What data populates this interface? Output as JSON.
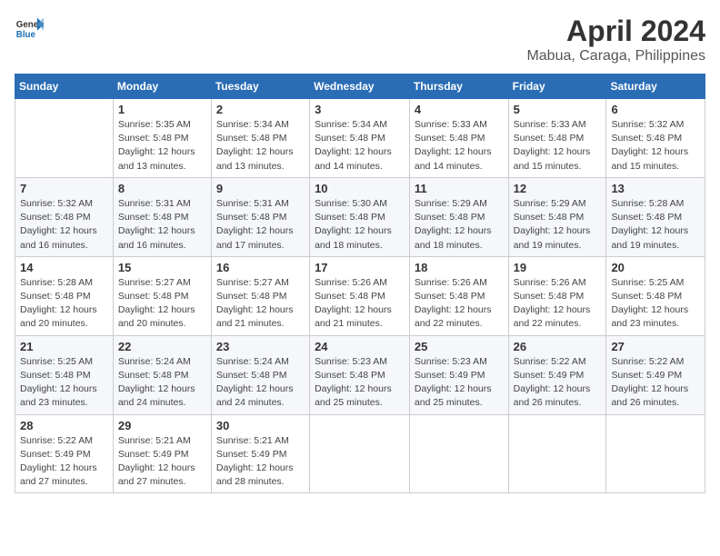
{
  "header": {
    "logo_line1": "General",
    "logo_line2": "Blue",
    "month": "April 2024",
    "location": "Mabua, Caraga, Philippines"
  },
  "columns": [
    "Sunday",
    "Monday",
    "Tuesday",
    "Wednesday",
    "Thursday",
    "Friday",
    "Saturday"
  ],
  "weeks": [
    [
      {
        "day": "",
        "info": ""
      },
      {
        "day": "1",
        "info": "Sunrise: 5:35 AM\nSunset: 5:48 PM\nDaylight: 12 hours\nand 13 minutes."
      },
      {
        "day": "2",
        "info": "Sunrise: 5:34 AM\nSunset: 5:48 PM\nDaylight: 12 hours\nand 13 minutes."
      },
      {
        "day": "3",
        "info": "Sunrise: 5:34 AM\nSunset: 5:48 PM\nDaylight: 12 hours\nand 14 minutes."
      },
      {
        "day": "4",
        "info": "Sunrise: 5:33 AM\nSunset: 5:48 PM\nDaylight: 12 hours\nand 14 minutes."
      },
      {
        "day": "5",
        "info": "Sunrise: 5:33 AM\nSunset: 5:48 PM\nDaylight: 12 hours\nand 15 minutes."
      },
      {
        "day": "6",
        "info": "Sunrise: 5:32 AM\nSunset: 5:48 PM\nDaylight: 12 hours\nand 15 minutes."
      }
    ],
    [
      {
        "day": "7",
        "info": "Sunrise: 5:32 AM\nSunset: 5:48 PM\nDaylight: 12 hours\nand 16 minutes."
      },
      {
        "day": "8",
        "info": "Sunrise: 5:31 AM\nSunset: 5:48 PM\nDaylight: 12 hours\nand 16 minutes."
      },
      {
        "day": "9",
        "info": "Sunrise: 5:31 AM\nSunset: 5:48 PM\nDaylight: 12 hours\nand 17 minutes."
      },
      {
        "day": "10",
        "info": "Sunrise: 5:30 AM\nSunset: 5:48 PM\nDaylight: 12 hours\nand 18 minutes."
      },
      {
        "day": "11",
        "info": "Sunrise: 5:29 AM\nSunset: 5:48 PM\nDaylight: 12 hours\nand 18 minutes."
      },
      {
        "day": "12",
        "info": "Sunrise: 5:29 AM\nSunset: 5:48 PM\nDaylight: 12 hours\nand 19 minutes."
      },
      {
        "day": "13",
        "info": "Sunrise: 5:28 AM\nSunset: 5:48 PM\nDaylight: 12 hours\nand 19 minutes."
      }
    ],
    [
      {
        "day": "14",
        "info": "Sunrise: 5:28 AM\nSunset: 5:48 PM\nDaylight: 12 hours\nand 20 minutes."
      },
      {
        "day": "15",
        "info": "Sunrise: 5:27 AM\nSunset: 5:48 PM\nDaylight: 12 hours\nand 20 minutes."
      },
      {
        "day": "16",
        "info": "Sunrise: 5:27 AM\nSunset: 5:48 PM\nDaylight: 12 hours\nand 21 minutes."
      },
      {
        "day": "17",
        "info": "Sunrise: 5:26 AM\nSunset: 5:48 PM\nDaylight: 12 hours\nand 21 minutes."
      },
      {
        "day": "18",
        "info": "Sunrise: 5:26 AM\nSunset: 5:48 PM\nDaylight: 12 hours\nand 22 minutes."
      },
      {
        "day": "19",
        "info": "Sunrise: 5:26 AM\nSunset: 5:48 PM\nDaylight: 12 hours\nand 22 minutes."
      },
      {
        "day": "20",
        "info": "Sunrise: 5:25 AM\nSunset: 5:48 PM\nDaylight: 12 hours\nand 23 minutes."
      }
    ],
    [
      {
        "day": "21",
        "info": "Sunrise: 5:25 AM\nSunset: 5:48 PM\nDaylight: 12 hours\nand 23 minutes."
      },
      {
        "day": "22",
        "info": "Sunrise: 5:24 AM\nSunset: 5:48 PM\nDaylight: 12 hours\nand 24 minutes."
      },
      {
        "day": "23",
        "info": "Sunrise: 5:24 AM\nSunset: 5:48 PM\nDaylight: 12 hours\nand 24 minutes."
      },
      {
        "day": "24",
        "info": "Sunrise: 5:23 AM\nSunset: 5:48 PM\nDaylight: 12 hours\nand 25 minutes."
      },
      {
        "day": "25",
        "info": "Sunrise: 5:23 AM\nSunset: 5:49 PM\nDaylight: 12 hours\nand 25 minutes."
      },
      {
        "day": "26",
        "info": "Sunrise: 5:22 AM\nSunset: 5:49 PM\nDaylight: 12 hours\nand 26 minutes."
      },
      {
        "day": "27",
        "info": "Sunrise: 5:22 AM\nSunset: 5:49 PM\nDaylight: 12 hours\nand 26 minutes."
      }
    ],
    [
      {
        "day": "28",
        "info": "Sunrise: 5:22 AM\nSunset: 5:49 PM\nDaylight: 12 hours\nand 27 minutes."
      },
      {
        "day": "29",
        "info": "Sunrise: 5:21 AM\nSunset: 5:49 PM\nDaylight: 12 hours\nand 27 minutes."
      },
      {
        "day": "30",
        "info": "Sunrise: 5:21 AM\nSunset: 5:49 PM\nDaylight: 12 hours\nand 28 minutes."
      },
      {
        "day": "",
        "info": ""
      },
      {
        "day": "",
        "info": ""
      },
      {
        "day": "",
        "info": ""
      },
      {
        "day": "",
        "info": ""
      }
    ]
  ]
}
